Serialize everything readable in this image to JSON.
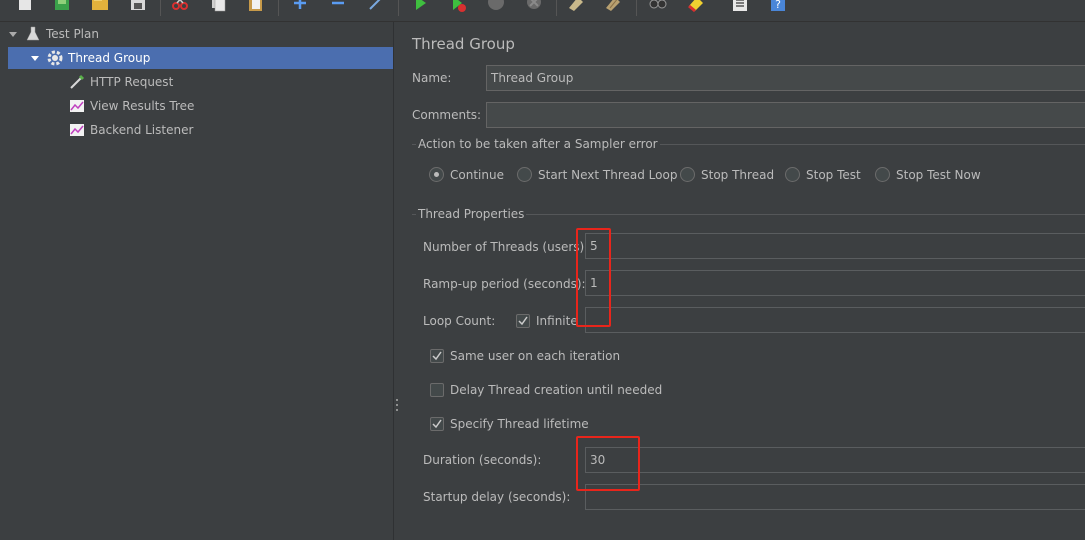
{
  "toolbar": {
    "icons": [
      "new-icon",
      "templates-icon",
      "open-icon",
      "save-icon",
      "cut-icon",
      "copy-icon",
      "paste-icon",
      "expand-icon",
      "collapse-icon",
      "toggle-icon",
      "start-icon",
      "start-no-pause-icon",
      "stop-icon",
      "shutdown-icon",
      "clear-icon",
      "clear-all-icon",
      "search-icon",
      "reset-search-icon",
      "function-helper-icon",
      "help-icon"
    ]
  },
  "tree": {
    "test_plan": "Test Plan",
    "thread_group": "Thread Group",
    "http_request": "HTTP Request",
    "view_results_tree": "View Results Tree",
    "backend_listener": "Backend Listener"
  },
  "panel": {
    "title": "Thread Group",
    "name_label": "Name:",
    "name_value": "Thread Group",
    "comments_label": "Comments:",
    "comments_value": "",
    "sampler_error": {
      "legend": "Action to be taken after a Sampler error",
      "options": [
        "Continue",
        "Start Next Thread Loop",
        "Stop Thread",
        "Stop Test",
        "Stop Test Now"
      ],
      "selected": "Continue"
    },
    "thread_properties": {
      "legend": "Thread Properties",
      "num_threads_label": "Number of Threads (users):",
      "num_threads_value": "5",
      "rampup_label": "Ramp-up period (seconds):",
      "rampup_value": "1",
      "loop_count_label": "Loop Count:",
      "infinite_label": "Infinite",
      "infinite_checked": true,
      "loop_count_value": "",
      "same_user_label": "Same user on each iteration",
      "same_user_checked": true,
      "delay_label": "Delay Thread creation until needed",
      "delay_checked": false,
      "lifetime_label": "Specify Thread lifetime",
      "lifetime_checked": true,
      "duration_label": "Duration (seconds):",
      "duration_value": "30",
      "startup_delay_label": "Startup delay (seconds):",
      "startup_delay_value": ""
    }
  },
  "colors": {
    "background": "#3c3f41",
    "selection": "#4b6eaf",
    "highlight_box": "#e8251b"
  }
}
